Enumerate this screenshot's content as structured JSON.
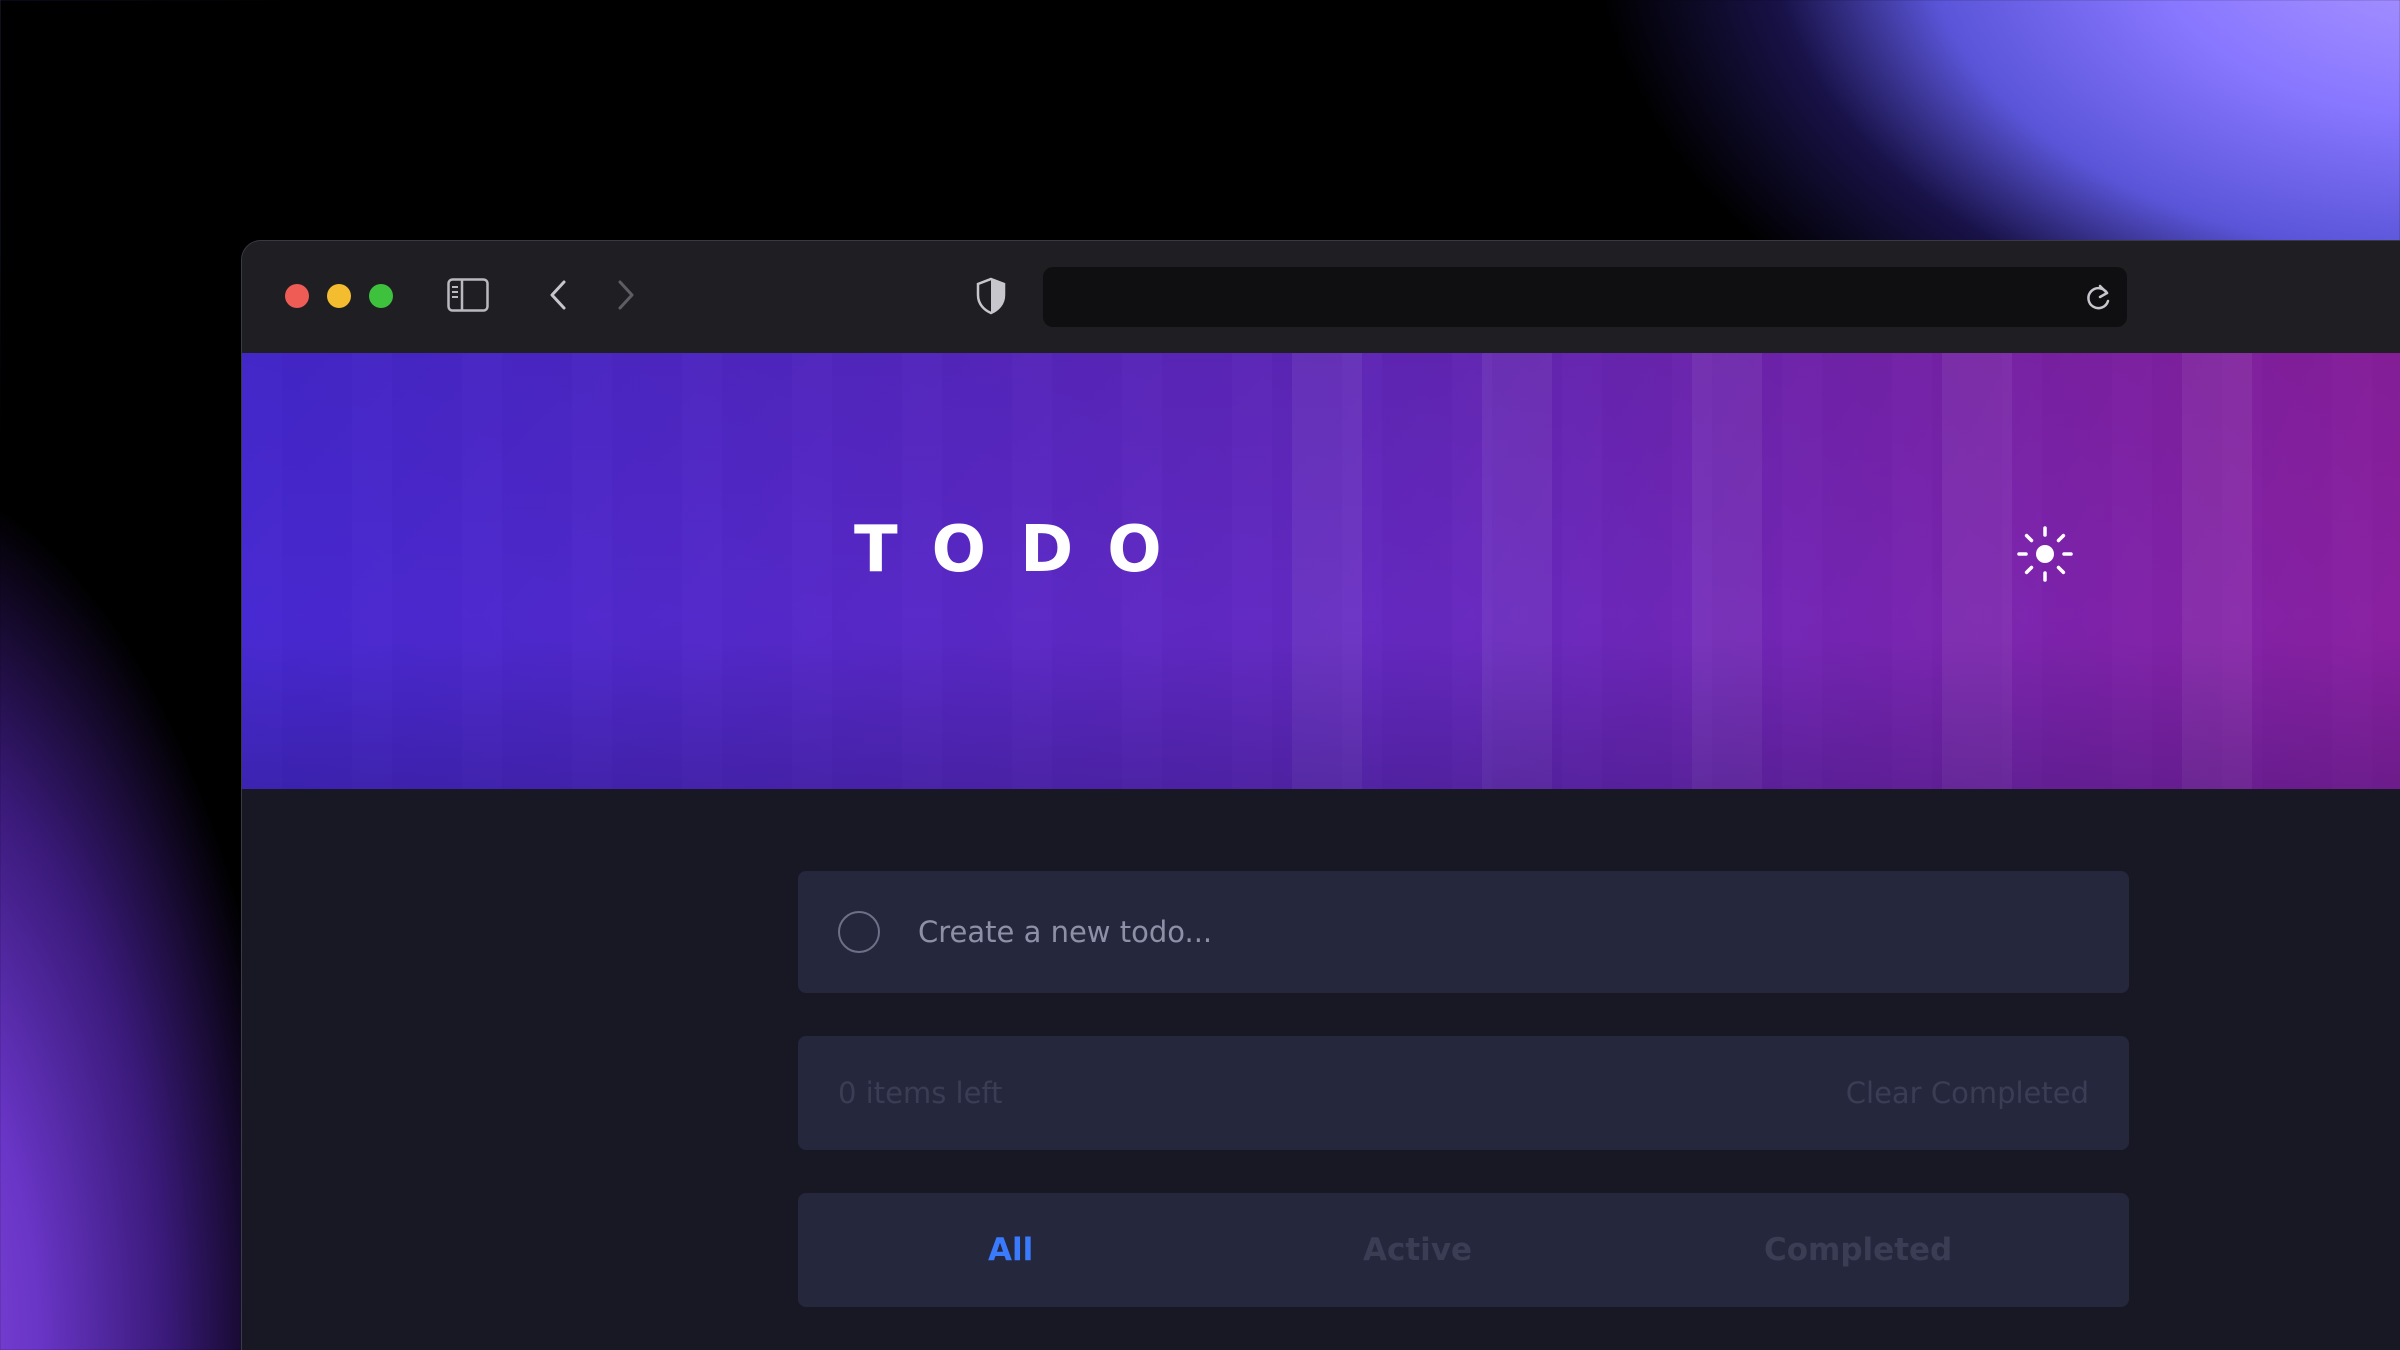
{
  "browser": {
    "traffic_lights": [
      "close",
      "minimize",
      "maximize"
    ],
    "address_value": ""
  },
  "hero": {
    "title": "TODO",
    "theme_icon": "sun-icon"
  },
  "new_todo": {
    "placeholder": "Create a new todo..."
  },
  "status": {
    "items_left": "0 items left",
    "clear_label": "Clear Completed"
  },
  "filters": {
    "all": "All",
    "active": "Active",
    "completed": "Completed",
    "selected": "All"
  },
  "colors": {
    "accent": "#3a7bfd",
    "card_bg": "#25273d",
    "page_bg": "#181824",
    "muted_text": "#3b3d55"
  }
}
